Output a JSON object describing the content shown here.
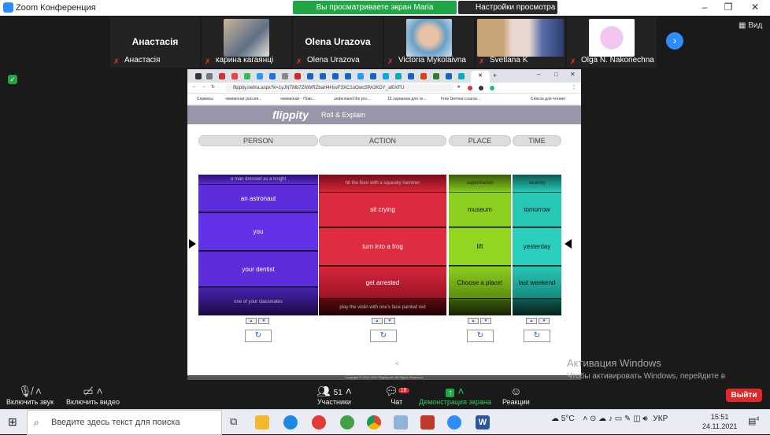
{
  "window": {
    "title": "Zoom Конференция",
    "share_banner": "Вы просматриваете экран Maria Sosnovskaya",
    "view_options": "Настройки просмотра",
    "view_label": "Вид"
  },
  "participants": [
    {
      "name": "Анастасія",
      "label": "Анастасія",
      "big_name": "Анастасія"
    },
    {
      "name": "карина кагаянці",
      "label": "карина кагаянці",
      "big_name": ""
    },
    {
      "name": "Olena Urazova",
      "label": "Olena Urazova",
      "big_name": "Olena Urazova"
    },
    {
      "name": "Victoria Mykolaivna",
      "label": "Victoria Mykolaivna",
      "big_name": ""
    },
    {
      "name": "Svetlana K",
      "label": "Svetlana K",
      "big_name": ""
    },
    {
      "name": "Olga N. Nakonechna",
      "label": "Olga N. Nakonechna",
      "big_name": ""
    }
  ],
  "browser": {
    "url": "flippity.net/ra.aspx?k=1yJNTMb7ZNWRZbaH4HsvF3XC1oOwc5PA3KDY_af0XFU",
    "bookmarks": [
      "Сервисы",
      "чемпионат россия...",
      "чемпионат - Поис...",
      "understand the pro...",
      "15 сериалов для те...",
      "Free German course...",
      "Список для чтения"
    ]
  },
  "flippity": {
    "logo": "flippity",
    "subtitle": "Roll & Explain",
    "columns": [
      "PERSON",
      "ACTION",
      "PLACE",
      "TIME"
    ],
    "person": [
      "a man dressed as a knight",
      "an astronaut",
      "you",
      "your dentist",
      "one of your classmates"
    ],
    "action": [
      "hit the floor with a squeaky hammer",
      "sit crying",
      "turn into a frog",
      "get arrested",
      "play the violin with one's face painted red"
    ],
    "place": [
      "supermarket",
      "museum",
      "lift",
      "Choose a place!",
      "roof"
    ],
    "time": [
      "recently",
      "tomorrow",
      "yesterday",
      "last weekend",
      "at the moment"
    ],
    "footer": "Copyright © 2012-2021 Flippity.net. All Rights Reserved."
  },
  "watermark": {
    "line1": "Активация Windows",
    "line2": "Чтобы активировать Windows, перейдите в раздел \"Параметры\"."
  },
  "toolbar": {
    "mute": "Включить звук",
    "video": "Включить видео",
    "participants": "Участники",
    "participants_count": "51",
    "chat": "Чат",
    "chat_badge": "18",
    "share": "Демонстрация экрана",
    "reactions": "Реакции",
    "leave": "Выйти"
  },
  "taskbar": {
    "search_placeholder": "Введите здесь текст для поиска",
    "temp": "5°C",
    "lang": "УКР",
    "time": "15:51",
    "date": "24.11.2021",
    "notif_count": "4"
  },
  "colors": {
    "purple": "#5c2bd8",
    "red": "#d9263a",
    "green": "#8ccf1f",
    "teal": "#27c7b5",
    "zoom_blue": "#2d8cff"
  }
}
